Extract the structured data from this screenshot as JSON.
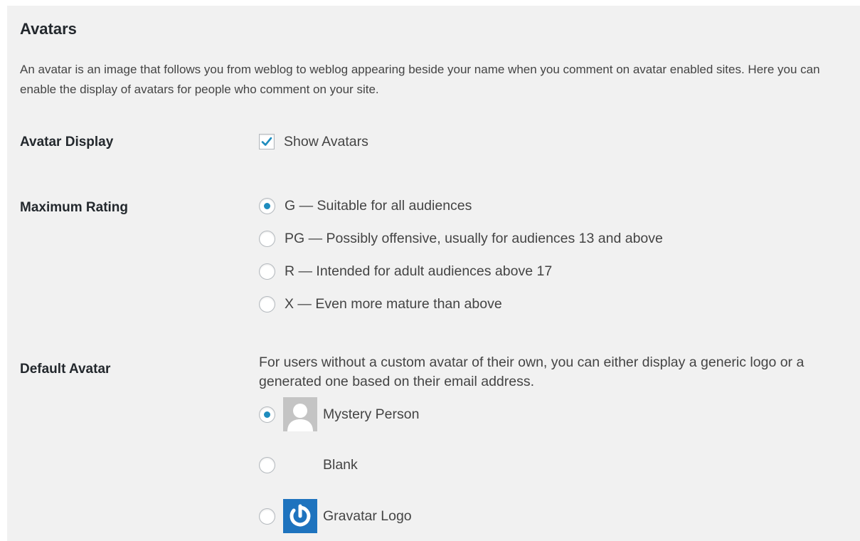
{
  "section": {
    "title": "Avatars",
    "description": "An avatar is an image that follows you from weblog to weblog appearing beside your name when you comment on avatar enabled sites. Here you can enable the display of avatars for people who comment on your site."
  },
  "avatar_display": {
    "label": "Avatar Display",
    "checkbox_label": "Show Avatars",
    "checked": true
  },
  "maximum_rating": {
    "label": "Maximum Rating",
    "selected": "G",
    "options": [
      {
        "value": "G",
        "label": "G — Suitable for all audiences"
      },
      {
        "value": "PG",
        "label": "PG — Possibly offensive, usually for audiences 13 and above"
      },
      {
        "value": "R",
        "label": "R — Intended for adult audiences above 17"
      },
      {
        "value": "X",
        "label": "X — Even more mature than above"
      }
    ]
  },
  "default_avatar": {
    "label": "Default Avatar",
    "description": "For users without a custom avatar of their own, you can either display a generic logo or a generated one based on their email address.",
    "selected": "mystery",
    "options": [
      {
        "value": "mystery",
        "label": "Mystery Person",
        "icon": "mystery-person-icon"
      },
      {
        "value": "blank",
        "label": "Blank",
        "icon": "blank-avatar-icon"
      },
      {
        "value": "gravatar_default",
        "label": "Gravatar Logo",
        "icon": "gravatar-logo-icon"
      }
    ]
  },
  "colors": {
    "panel_bg": "#f1f1f1",
    "accent": "#1e8cbe",
    "gravatar_blue": "#1e73be",
    "mystery_bg": "#c4c4c4"
  }
}
